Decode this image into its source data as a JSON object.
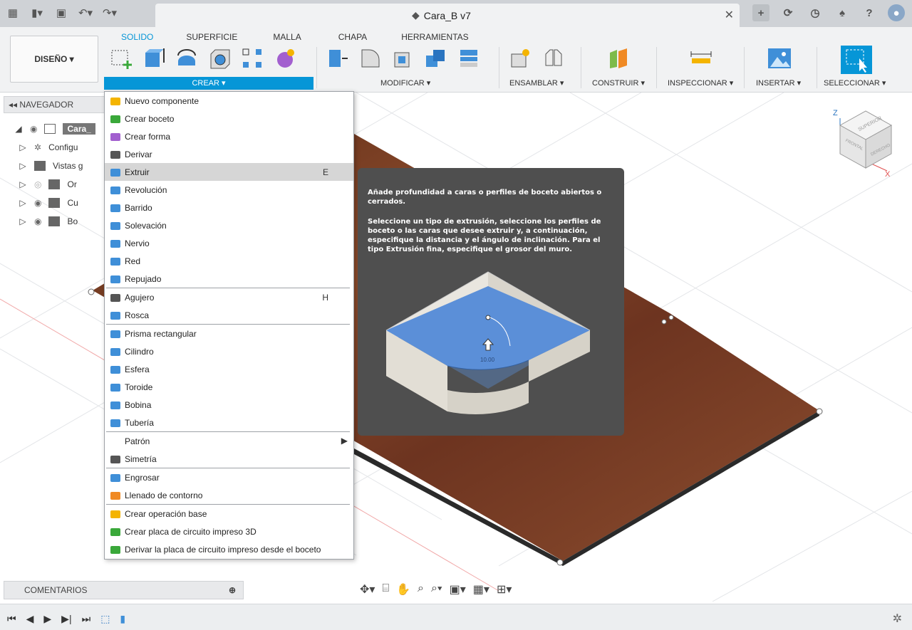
{
  "titlebar": {
    "doc_title": "Cara_B v7",
    "icons": [
      "grid-icon",
      "file-icon",
      "save-icon",
      "undo-icon",
      "redo-icon"
    ],
    "right_icons": [
      "add-tab-icon",
      "sync-icon",
      "history-icon",
      "notification-icon",
      "help-icon",
      "avatar"
    ]
  },
  "ribbon": {
    "tabs": [
      "SOLIDO",
      "SUPERFICIE",
      "MALLA",
      "CHAPA",
      "HERRAMIENTAS"
    ],
    "active_tab": "SOLIDO",
    "workspace": "DISEÑO ▾",
    "groups": {
      "crear": "CREAR ▾",
      "modificar": "MODIFICAR ▾",
      "ensamblar": "ENSAMBLAR ▾",
      "construir": "CONSTRUIR ▾",
      "inspeccionar": "INSPECCIONAR ▾",
      "insertar": "INSERTAR ▾",
      "seleccionar": "SELECCIONAR ▾"
    }
  },
  "navigator": {
    "title": "NAVEGADOR",
    "items": [
      {
        "label": "Cara_"
      },
      {
        "label": "Configu"
      },
      {
        "label": "Vistas g"
      },
      {
        "label": "Or"
      },
      {
        "label": "Cu"
      },
      {
        "label": "Bo"
      }
    ]
  },
  "menu": {
    "items": [
      {
        "label": "Nuevo componente",
        "icon": "new-component-icon"
      },
      {
        "label": "Crear boceto",
        "icon": "sketch-icon"
      },
      {
        "label": "Crear forma",
        "icon": "form-icon"
      },
      {
        "label": "Derivar",
        "icon": "derive-icon"
      },
      {
        "label": "Extruir",
        "icon": "extrude-icon",
        "shortcut": "E",
        "highlighted": true
      },
      {
        "label": "Revolución",
        "icon": "revolve-icon"
      },
      {
        "label": "Barrido",
        "icon": "sweep-icon"
      },
      {
        "label": "Solevación",
        "icon": "loft-icon"
      },
      {
        "label": "Nervio",
        "icon": "rib-icon"
      },
      {
        "label": "Red",
        "icon": "web-icon"
      },
      {
        "label": "Repujado",
        "icon": "emboss-icon"
      },
      {
        "label": "Agujero",
        "icon": "hole-icon",
        "shortcut": "H"
      },
      {
        "label": "Rosca",
        "icon": "thread-icon"
      },
      {
        "label": "Prisma rectangular",
        "icon": "box-icon"
      },
      {
        "label": "Cilindro",
        "icon": "cylinder-icon"
      },
      {
        "label": "Esfera",
        "icon": "sphere-icon"
      },
      {
        "label": "Toroide",
        "icon": "torus-icon"
      },
      {
        "label": "Bobina",
        "icon": "coil-icon"
      },
      {
        "label": "Tubería",
        "icon": "pipe-icon"
      },
      {
        "label": "Patrón",
        "submenu": true
      },
      {
        "label": "Simetría",
        "icon": "mirror-icon"
      },
      {
        "label": "Engrosar",
        "icon": "thicken-icon"
      },
      {
        "label": "Llenado de contorno",
        "icon": "boundary-fill-icon"
      },
      {
        "label": "Crear operación base",
        "icon": "base-feature-icon"
      },
      {
        "label": "Crear placa de circuito impreso 3D",
        "icon": "pcb-icon"
      },
      {
        "label": "Derivar la placa de circuito impreso desde el boceto",
        "icon": "pcb-derive-icon"
      }
    ]
  },
  "tooltip": {
    "line1": "Añade profundidad a caras o perfiles de boceto abiertos o cerrados.",
    "line2": "Seleccione un tipo de extrusión, seleccione los perfiles de boceto o las caras que desee extruir y, a continuación, especifique la distancia y el ángulo de inclinación. Para el tipo Extrusión fina, especifique el grosor del muro.",
    "dim_value": "10.00"
  },
  "viewcube": {
    "top": "SUPERIOR",
    "front": "FRONTAL",
    "right": "DERECHO",
    "z": "Z",
    "x": "X"
  },
  "comments": {
    "label": "COMENTARIOS",
    "add": "⊕"
  },
  "colors": {
    "accent": "#0696d7",
    "wood": "#7a3a22",
    "tooltip_bg": "#4f4f4f"
  }
}
